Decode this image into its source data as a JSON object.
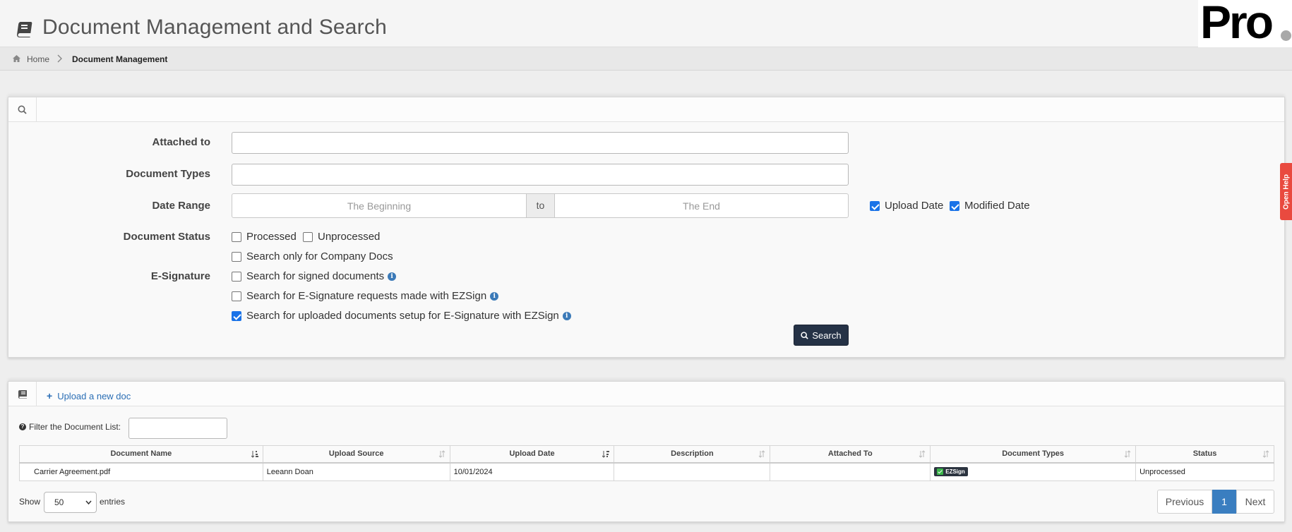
{
  "header": {
    "title": "Document Management and Search",
    "logo_text": "Pro"
  },
  "breadcrumb": {
    "home": "Home",
    "current": "Document Management"
  },
  "search_form": {
    "attached_to_label": "Attached to",
    "attached_to_value": "",
    "document_types_label": "Document Types",
    "document_types_value": "",
    "date_range_label": "Date Range",
    "date_from_placeholder": "The Beginning",
    "date_to_label": "to",
    "date_to_placeholder": "The End",
    "upload_date_label": "Upload Date",
    "upload_date_checked": true,
    "modified_date_label": "Modified Date",
    "modified_date_checked": true,
    "document_status_label": "Document Status",
    "processed_label": "Processed",
    "processed_checked": false,
    "unprocessed_label": "Unprocessed",
    "unprocessed_checked": false,
    "company_docs_label": "Search only for Company Docs",
    "company_docs_checked": false,
    "esignature_label": "E-Signature",
    "signed_docs_label": "Search for signed documents",
    "signed_docs_checked": false,
    "ezsign_requests_label": "Search for E-Signature requests made with EZSign",
    "ezsign_requests_checked": false,
    "ezsign_uploaded_label": "Search for uploaded documents setup for E-Signature with EZSign",
    "ezsign_uploaded_checked": true,
    "search_button": "Search"
  },
  "help_tab": "Open Help",
  "documents": {
    "upload_link": "Upload a new doc",
    "filter_label": "Filter the Document List:",
    "filter_value": "",
    "columns": [
      "Document Name",
      "Upload Source",
      "Upload Date",
      "Description",
      "Attached To",
      "Document Types",
      "Status"
    ],
    "rows": [
      {
        "name": "Carrier Agreement.pdf",
        "upload_source": "Leeann Doan",
        "upload_date": "10/01/2024",
        "description": "",
        "attached_to": "",
        "document_type_badge": "EZSign",
        "status": "Unprocessed"
      }
    ],
    "show_label": "Show",
    "page_size": "50",
    "entries_label": "entries",
    "pagination": {
      "previous": "Previous",
      "current": "1",
      "next": "Next"
    }
  },
  "colors": {
    "search_button_bg": "#253246",
    "link": "#2a6eb5",
    "pagination_active": "#3a7ec0",
    "help_tab": "#e94a3f",
    "checkbox_checked": "#1a73e8"
  }
}
